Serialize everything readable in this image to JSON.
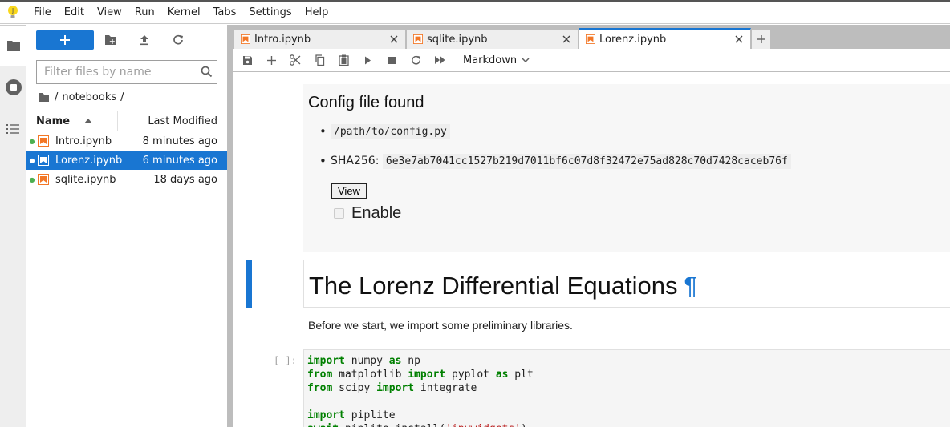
{
  "menu": [
    "File",
    "Edit",
    "View",
    "Run",
    "Kernel",
    "Tabs",
    "Settings",
    "Help"
  ],
  "filebrowser": {
    "filter_placeholder": "Filter files by name",
    "breadcrumb": {
      "sep1": "/",
      "folder": "notebooks",
      "sep2": "/"
    },
    "columns": {
      "name": "Name",
      "modified": "Last Modified"
    },
    "files": [
      {
        "name": "Intro.ipynb",
        "modified": "8 minutes ago",
        "selected": false
      },
      {
        "name": "Lorenz.ipynb",
        "modified": "6 minutes ago",
        "selected": true
      },
      {
        "name": "sqlite.ipynb",
        "modified": "18 days ago",
        "selected": false
      }
    ]
  },
  "tabs": [
    {
      "label": "Intro.ipynb",
      "current": false
    },
    {
      "label": "sqlite.ipynb",
      "current": false
    },
    {
      "label": "Lorenz.ipynb",
      "current": true
    }
  ],
  "toolbar": {
    "cell_type": "Markdown"
  },
  "output": {
    "title": "Config file found",
    "path": "/path/to/config.py",
    "sha_label": "SHA256:",
    "sha_value": "6e3e7ab7041cc1527b219d7011bf6c07d8f32472e75ad828c70d7428caceb76f",
    "view_button": "View",
    "enable_label": "Enable"
  },
  "markdown": {
    "heading": "The Lorenz Differential Equations",
    "pilcrow": "¶",
    "paragraph": "Before we start, we import some preliminary libraries."
  },
  "code": {
    "prompt": "[ ]:",
    "lines": [
      [
        {
          "t": "import",
          "k": true
        },
        {
          "t": " numpy "
        },
        {
          "t": "as",
          "k": true
        },
        {
          "t": " np"
        }
      ],
      [
        {
          "t": "from",
          "k": true
        },
        {
          "t": " matplotlib "
        },
        {
          "t": "import",
          "k": true
        },
        {
          "t": " pyplot "
        },
        {
          "t": "as",
          "k": true
        },
        {
          "t": " plt"
        }
      ],
      [
        {
          "t": "from",
          "k": true
        },
        {
          "t": " scipy "
        },
        {
          "t": "import",
          "k": true
        },
        {
          "t": " integrate"
        }
      ],
      [],
      [
        {
          "t": "import",
          "k": true
        },
        {
          "t": " piplite"
        }
      ],
      [
        {
          "t": "await",
          "k": true
        },
        {
          "t": " piplite.install("
        },
        {
          "t": "'ipywidgets'",
          "s": true
        },
        {
          "t": ")"
        }
      ]
    ]
  }
}
